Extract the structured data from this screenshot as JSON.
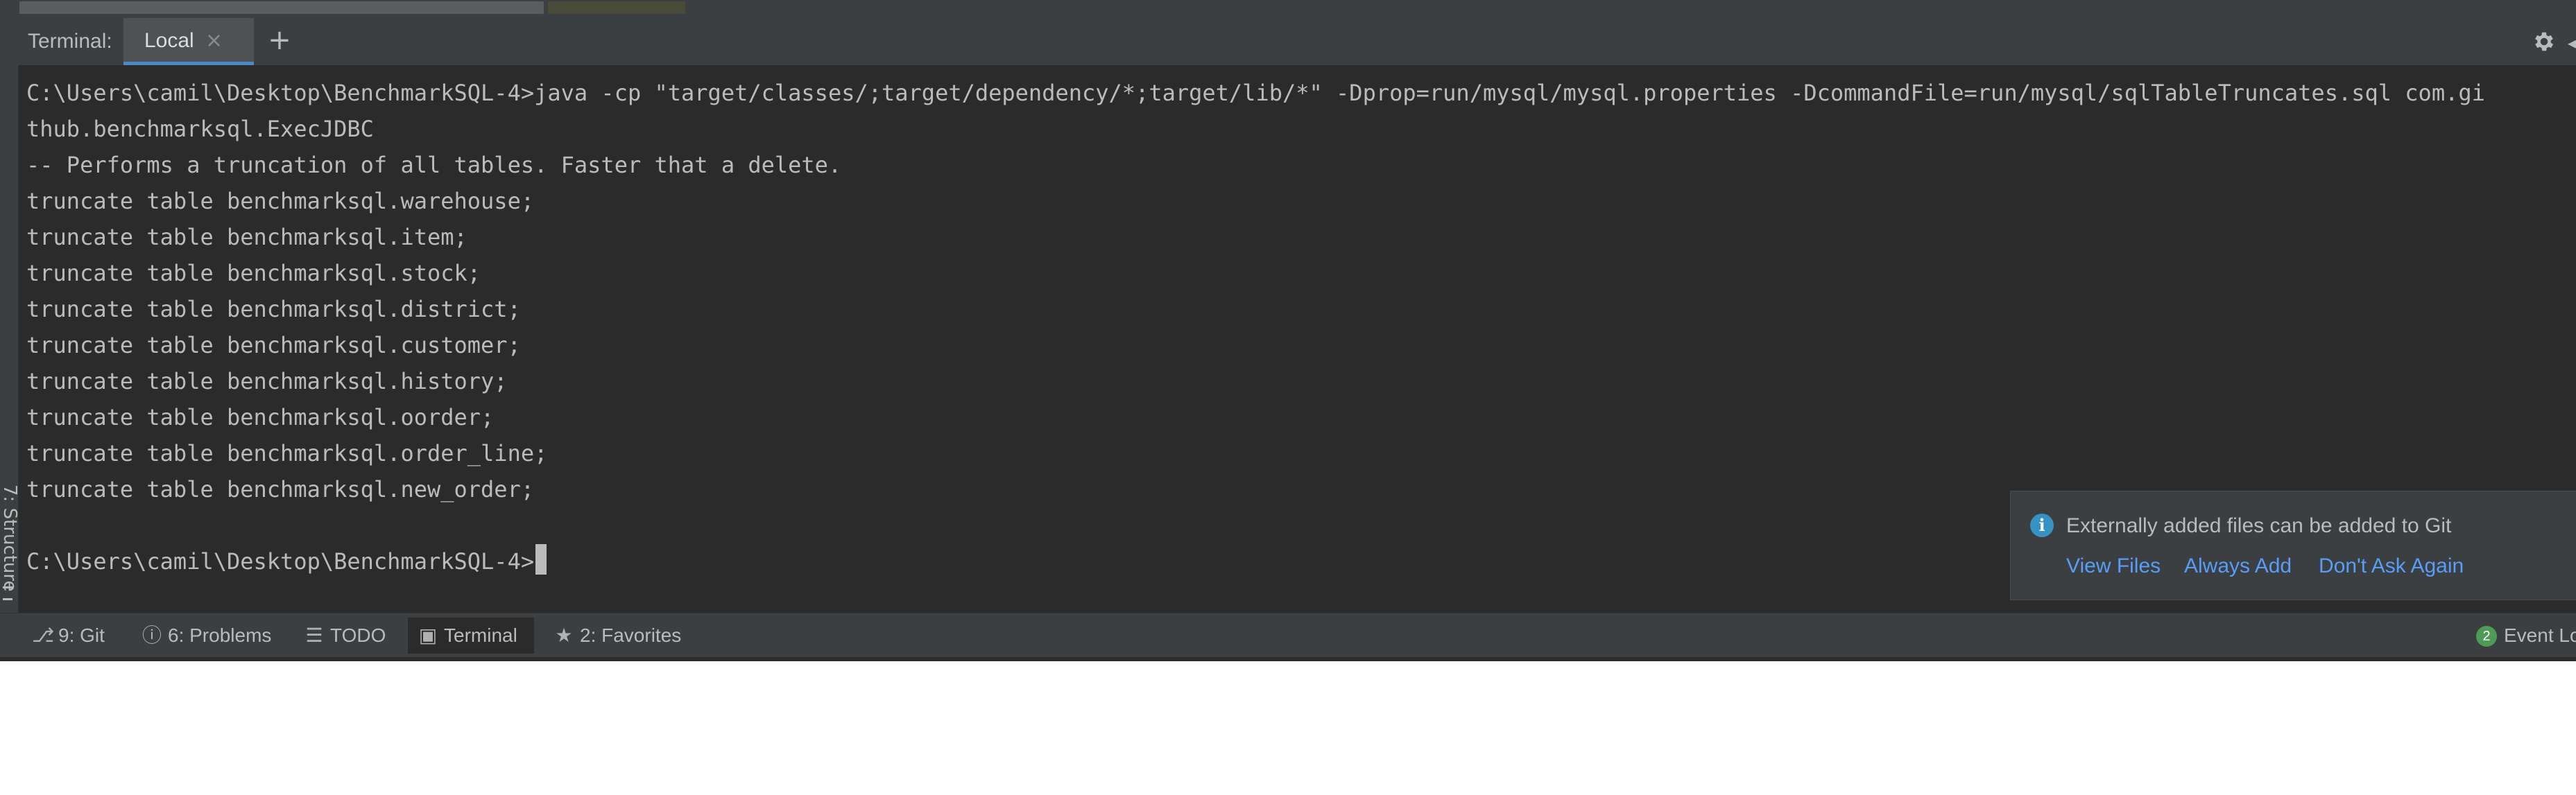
{
  "terminal": {
    "header_label": "Terminal:",
    "tab_local": "Local",
    "tab_close": "×",
    "add_tab": "+",
    "lines": [
      "C:\\Users\\camil\\Desktop\\BenchmarkSQL-4>java -cp \"target/classes/;target/dependency/*;target/lib/*\" -Dprop=run/mysql/mysql.properties -DcommandFile=run/mysql/sqlTableTruncates.sql com.gi",
      "thub.benchmarksql.ExecJDBC",
      "-- Performs a truncation of all tables. Faster that a delete.",
      "truncate table benchmarksql.warehouse;",
      "truncate table benchmarksql.item;",
      "truncate table benchmarksql.stock;",
      "truncate table benchmarksql.district;",
      "truncate table benchmarksql.customer;",
      "truncate table benchmarksql.history;",
      "truncate table benchmarksql.oorder;",
      "truncate table benchmarksql.order_line;",
      "truncate table benchmarksql.new_order;"
    ],
    "prompt": "C:\\Users\\camil\\Desktop\\BenchmarkSQL-4>"
  },
  "left_stripe": {
    "structure_label": "7: Structure"
  },
  "notification": {
    "message": "Externally added files can be added to Git",
    "links": [
      "View Files",
      "Always Add",
      "Don't Ask Again"
    ]
  },
  "bottom_toolbar": {
    "git": "9: Git",
    "problems": "6: Problems",
    "todo": "TODO",
    "terminal": "Terminal",
    "favorites": "2: Favorites",
    "event_log_count": "2",
    "event_log": "Event Lo"
  },
  "colors": {
    "background": "#2b2b2b",
    "panel": "#3c3f41",
    "text": "#bbbbbb",
    "link": "#589df6",
    "accent": "#4a88c7"
  },
  "icons": {
    "settings": "gear-icon",
    "info": "info-icon",
    "git": "branch-icon",
    "problems": "exclamation-icon",
    "todo": "list-icon",
    "terminal": "terminal-icon",
    "favorites": "star-icon"
  }
}
